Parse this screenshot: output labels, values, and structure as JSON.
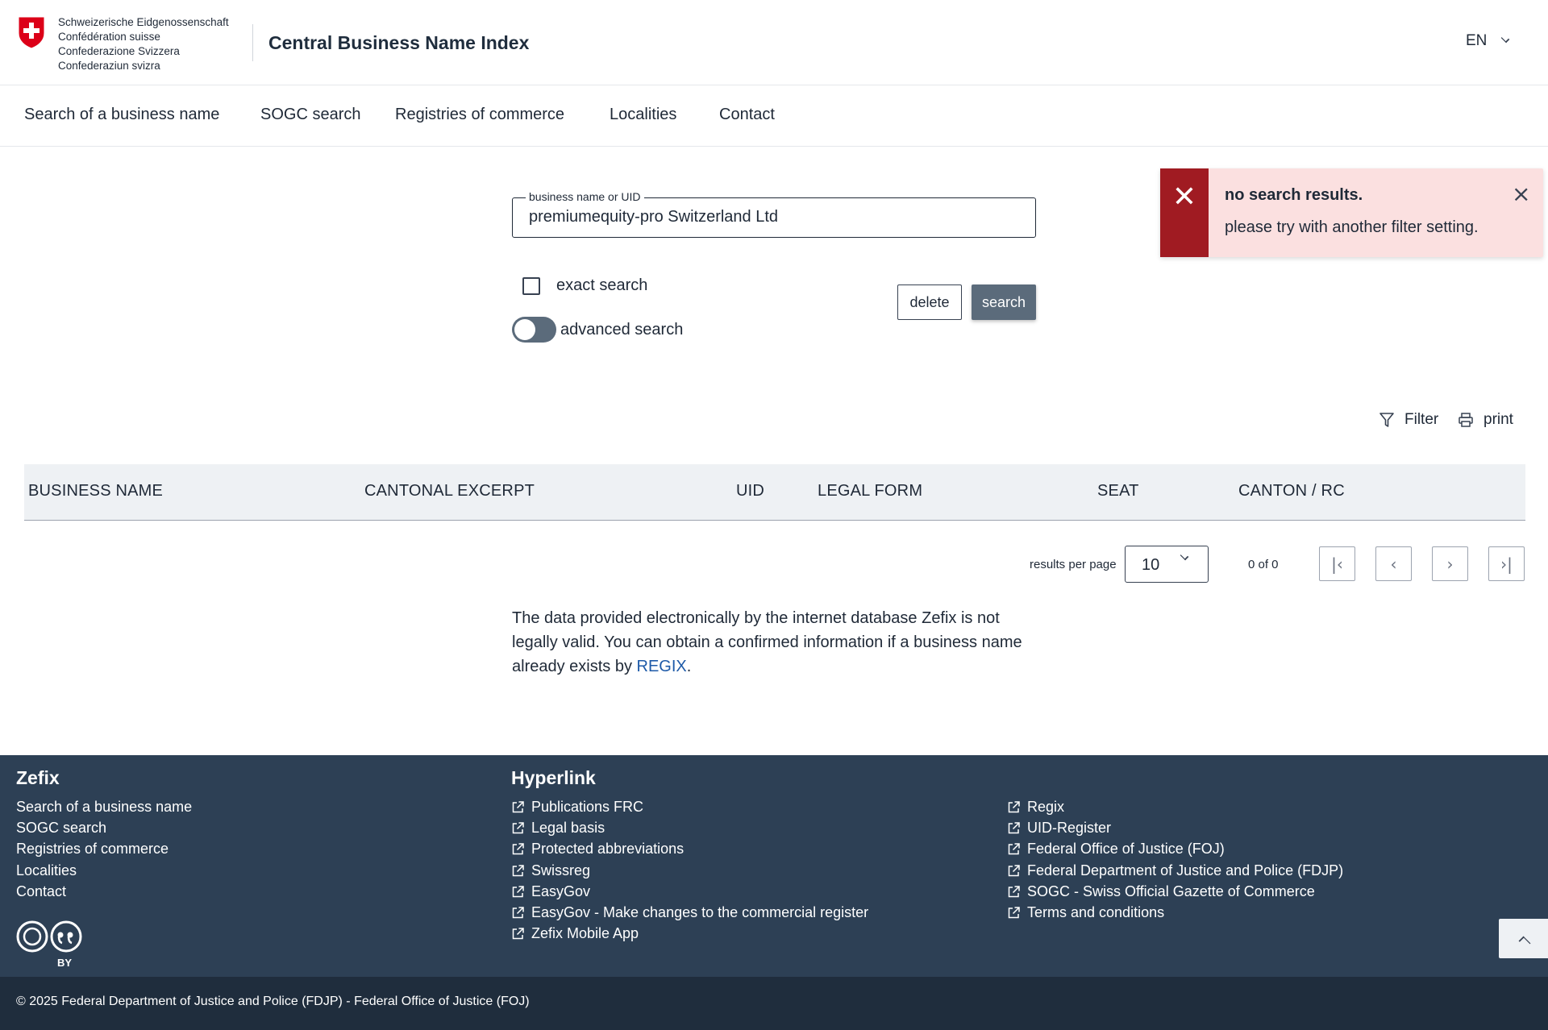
{
  "header": {
    "confederation_lines": [
      "Schweizerische Eidgenossenschaft",
      "Confédération suisse",
      "Confederazione Svizzera",
      "Confederaziun svizra"
    ],
    "title": "Central Business Name Index",
    "language": "EN"
  },
  "nav": {
    "items": [
      {
        "label": "Search of a business name"
      },
      {
        "label": "SOGC search"
      },
      {
        "label": "Registries of commerce"
      },
      {
        "label": "Localities"
      },
      {
        "label": "Contact"
      }
    ]
  },
  "search": {
    "field_label": "business name or UID",
    "value": "premiumequity-pro Switzerland Ltd",
    "exact_label": "exact search",
    "exact_checked": false,
    "advanced_label": "advanced search",
    "advanced_on": false,
    "delete_label": "delete",
    "search_label": "search"
  },
  "alert": {
    "title": "no search results.",
    "message": "please try with another filter setting."
  },
  "tools": {
    "filter_label": "Filter",
    "print_label": "print"
  },
  "table": {
    "columns": [
      "BUSINESS NAME",
      "CANTONAL EXCERPT",
      "UID",
      "LEGAL FORM",
      "SEAT",
      "CANTON / RC"
    ],
    "rows": []
  },
  "pagination": {
    "rpp_label": "results per page",
    "rpp_value": "10",
    "page_info": "0 of 0"
  },
  "disclaimer": {
    "text": "The data provided electronically by the internet database Zefix is not legally valid. You can obtain a confirmed information if a business name already exists by ",
    "link": "REGIX",
    "end": "."
  },
  "footer": {
    "col1": {
      "heading": "Zefix",
      "links": [
        "Search of a business name",
        "SOGC search",
        "Registries of commerce",
        "Localities",
        "Contact"
      ]
    },
    "col2": {
      "heading": "Hyperlink",
      "links": [
        "Publications FRC",
        "Legal basis",
        "Protected abbreviations",
        "Swissreg",
        "EasyGov",
        "EasyGov - Make changes to the commercial register",
        "Zefix Mobile App"
      ]
    },
    "col3": {
      "links": [
        "Regix",
        "UID-Register",
        "Federal Office of Justice (FOJ)",
        "Federal Department of Justice and Police (FDJP)",
        "SOGC - Swiss Official Gazette of Commerce",
        "Terms and conditions"
      ]
    },
    "cc_by": "BY",
    "copyright": "© 2025 Federal Department of Justice and Police (FDJP) - Federal Office of Justice (FOJ)"
  },
  "colors": {
    "swiss_red": "#dc0018",
    "alert_dark": "#a01b22",
    "alert_bg": "#fbe0e0",
    "footer_bg": "#2d4055",
    "bottom_bar": "#1f2d3d",
    "primary_button": "#5b6b7b",
    "link": "#1e5aa8"
  }
}
